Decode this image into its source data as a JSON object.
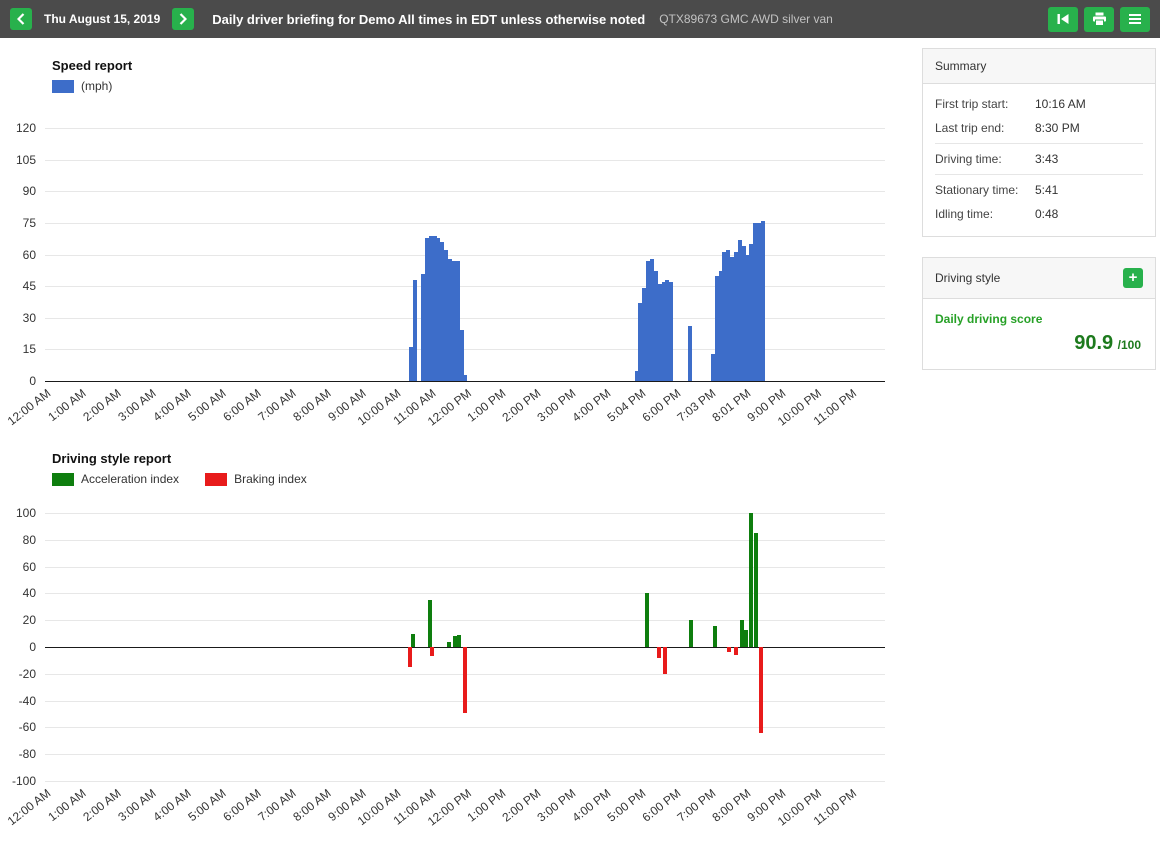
{
  "colors": {
    "accent": "#28b14c",
    "topbar": "#4b4b4b",
    "bar_blue": "#3d6dc9",
    "accel_green": "#0e7e0e",
    "brake_red": "#e81b1b",
    "score_green": "#1d7a1d",
    "score_label_green": "#27a127"
  },
  "header": {
    "date": "Thu August 15, 2019",
    "title": "Daily driver briefing for Demo All times in EDT unless otherwise noted",
    "subtitle": "QTX89673 GMC AWD silver van",
    "icons": {
      "prev": "chevron-left",
      "next": "chevron-right",
      "first": "skip-to-start",
      "print": "printer",
      "menu": "hamburger-menu"
    }
  },
  "summary": {
    "title": "Summary",
    "rows": [
      {
        "label": "First trip start:",
        "value": "10:16 AM",
        "divider_after": false
      },
      {
        "label": "Last trip end:",
        "value": "8:30 PM",
        "divider_after": true
      },
      {
        "label": "Driving time:",
        "value": "3:43",
        "divider_after": true
      },
      {
        "label": "Stationary time:",
        "value": "5:41",
        "divider_after": false
      },
      {
        "label": "Idling time:",
        "value": "0:48",
        "divider_after": false
      }
    ]
  },
  "driving_style": {
    "title": "Driving style",
    "add_icon": "plus",
    "add_icon_glyph": "+",
    "score_label": "Daily driving score",
    "score": "90.9",
    "score_suffix": "/100"
  },
  "chart_data": [
    {
      "type": "bar",
      "title": "Speed report",
      "xlabel": "",
      "ylabel": "mph",
      "ylim": [
        0,
        120
      ],
      "yticks": [
        120,
        105,
        90,
        75,
        60,
        45,
        30,
        15,
        0
      ],
      "grid": true,
      "legend_position": "top-left",
      "x_domain_hours": [
        0,
        24
      ],
      "x_labels": [
        "12:00 AM",
        "1:00 AM",
        "2:00 AM",
        "3:00 AM",
        "4:00 AM",
        "5:00 AM",
        "6:00 AM",
        "7:00 AM",
        "8:00 AM",
        "9:00 AM",
        "10:00 AM",
        "11:00 AM",
        "12:00 PM",
        "1:00 PM",
        "2:00 PM",
        "3:00 PM",
        "4:00 PM",
        "5:04 PM",
        "6:00 PM",
        "7:03 PM",
        "8:01 PM",
        "9:00 PM",
        "10:00 PM",
        "11:00 PM"
      ],
      "series": [
        {
          "id": "speed",
          "name": "(mph)",
          "color": "#3d6dc9",
          "points": [
            [
              10.45,
              16
            ],
            [
              10.57,
              48
            ],
            [
              10.8,
              51
            ],
            [
              10.91,
              68
            ],
            [
              11.02,
              69
            ],
            [
              11.13,
              69
            ],
            [
              11.24,
              68
            ],
            [
              11.35,
              66
            ],
            [
              11.46,
              62
            ],
            [
              11.57,
              58
            ],
            [
              11.68,
              57
            ],
            [
              11.79,
              57
            ],
            [
              11.9,
              24
            ],
            [
              12.01,
              3
            ],
            [
              16.9,
              5
            ],
            [
              17.01,
              37
            ],
            [
              17.12,
              44
            ],
            [
              17.23,
              57
            ],
            [
              17.34,
              58
            ],
            [
              17.45,
              52
            ],
            [
              17.56,
              46
            ],
            [
              17.67,
              47
            ],
            [
              17.78,
              48
            ],
            [
              17.89,
              47
            ],
            [
              18.43,
              26
            ],
            [
              19.08,
              13
            ],
            [
              19.19,
              50
            ],
            [
              19.3,
              52
            ],
            [
              19.41,
              61
            ],
            [
              19.52,
              62
            ],
            [
              19.63,
              59
            ],
            [
              19.74,
              61
            ],
            [
              19.85,
              67
            ],
            [
              19.96,
              64
            ],
            [
              20.07,
              60
            ],
            [
              20.18,
              65
            ],
            [
              20.29,
              75
            ],
            [
              20.4,
              75
            ],
            [
              20.51,
              76
            ]
          ]
        }
      ]
    },
    {
      "type": "bar",
      "title": "Driving style report",
      "xlabel": "",
      "ylabel": "index",
      "ylim": [
        -100,
        100
      ],
      "yticks": [
        100,
        80,
        60,
        40,
        20,
        0,
        -20,
        -40,
        -60,
        -80,
        -100
      ],
      "grid": true,
      "legend_position": "top-left",
      "x_domain_hours": [
        0,
        24
      ],
      "x_labels": [
        "12:00 AM",
        "1:00 AM",
        "2:00 AM",
        "3:00 AM",
        "4:00 AM",
        "5:00 AM",
        "6:00 AM",
        "7:00 AM",
        "8:00 AM",
        "9:00 AM",
        "10:00 AM",
        "11:00 AM",
        "12:00 PM",
        "1:00 PM",
        "2:00 PM",
        "3:00 PM",
        "4:00 PM",
        "5:00 PM",
        "6:00 PM",
        "7:00 PM",
        "8:00 PM",
        "9:00 PM",
        "10:00 PM",
        "11:00 PM"
      ],
      "series": [
        {
          "id": "acceleration",
          "name": "Acceleration index",
          "color": "#0e7e0e",
          "points": [
            [
              10.5,
              10
            ],
            [
              11.0,
              35
            ],
            [
              11.55,
              4
            ],
            [
              11.72,
              8
            ],
            [
              11.84,
              9
            ],
            [
              17.2,
              40
            ],
            [
              18.45,
              20
            ],
            [
              19.15,
              16
            ],
            [
              19.9,
              20
            ],
            [
              20.02,
              13
            ],
            [
              20.18,
              100
            ],
            [
              20.32,
              85
            ]
          ]
        },
        {
          "id": "braking",
          "name": "Braking index",
          "color": "#e81b1b",
          "points": [
            [
              10.43,
              -15
            ],
            [
              11.06,
              -7
            ],
            [
              12.0,
              -49
            ],
            [
              17.55,
              -8
            ],
            [
              17.72,
              -20
            ],
            [
              19.55,
              -4
            ],
            [
              19.75,
              -6
            ],
            [
              20.45,
              -64
            ]
          ]
        }
      ]
    }
  ]
}
